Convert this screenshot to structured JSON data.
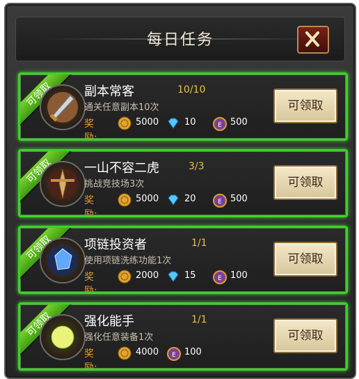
{
  "dialog": {
    "title": "每日任务"
  },
  "tasks": [
    {
      "ribbon": "可领取",
      "name": "副本常客",
      "progress": "10/10",
      "desc": "通关任意副本10次",
      "reward_label": "奖励:",
      "gold": "5000",
      "diamond": "10",
      "exp": "500",
      "claim": "可领取"
    },
    {
      "ribbon": "可领取",
      "name": "一山不容二虎",
      "progress": "3/3",
      "desc": "挑战竞技场3次",
      "reward_label": "奖励:",
      "gold": "5000",
      "diamond": "20",
      "exp": "500",
      "claim": "可领取"
    },
    {
      "ribbon": "可领取",
      "name": "项链投资者",
      "progress": "1/1",
      "desc": "使用项链洗练功能1次",
      "reward_label": "奖励:",
      "gold": "2000",
      "diamond": "15",
      "exp": "100",
      "claim": "可领取"
    },
    {
      "ribbon": "可领取",
      "name": "强化能手",
      "progress": "1/1",
      "desc": "强化任意装备1次",
      "reward_label": "奖励:",
      "gold": "4000",
      "exp": "100",
      "claim": "可领取"
    }
  ],
  "colors": {
    "active_border": "#3fd02d",
    "progress": "#e5c24a",
    "reward_label": "#e69b26"
  }
}
